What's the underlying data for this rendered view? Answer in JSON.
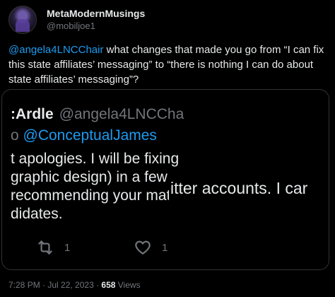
{
  "user": {
    "display_name": "MetaModernMusings",
    "handle": "@mobiljoe1"
  },
  "tweet": {
    "mention": "@angela4LNCChair",
    "text": " what changes that made you go from “I can fix this state affiliates’ messaging” to “there is nothing I can do about state affiliates’ messaging”?"
  },
  "screenshot": {
    "name": ":Ardle",
    "handle": "@angela4LNCCha",
    "reply_prefix": "o ",
    "reply_mention": "@ConceptualJames",
    "lines": [
      "t apologies. I will be fixing",
      "graphic design) in a few r",
      "recommending your mat",
      "didates."
    ],
    "overlay_text": "itter accounts. I car",
    "retweet_count": "1",
    "like_count": "1",
    "icons": [
      "retweet-icon",
      "heart-icon"
    ]
  },
  "meta": {
    "timestamp": "7:28 PM · Jul 22, 2023 · ",
    "views_count": "658",
    "views_label": " Views"
  }
}
